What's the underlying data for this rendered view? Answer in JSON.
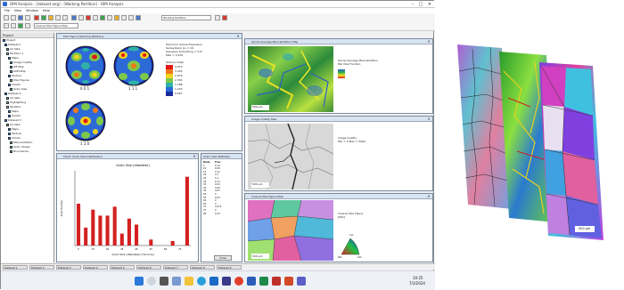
{
  "window": {
    "title": "OIM Analysis - [dataset.ang] - [Working Partition] - OIM Analysis",
    "controls": [
      "–",
      "□",
      "✕"
    ]
  },
  "menu": [
    "File",
    "View",
    "Window",
    "Help"
  ],
  "toolbar": {
    "partition_combo": "Working Partition",
    "map_combo": "Inverse Pole Figure Map"
  },
  "tree": {
    "header": "Project",
    "items": [
      "Project",
      "Dataset 1",
      "All data",
      "Partition 1",
      "Maps",
      "Image Quality",
      "IPF Map",
      "KAM Map",
      "Texture",
      "Pole Figures",
      "Charts",
      "Grain Size",
      "Dataset 2",
      "All data",
      "Highlighting",
      "Partition",
      "Maps",
      "Charts",
      "Dataset 3",
      "All data",
      "Maps",
      "Texture",
      "Charts",
      "Misorientation",
      "Grain Shape",
      "Boundaries"
    ]
  },
  "panels": {
    "pole_figure": {
      "title": "Pole Figure [Working Partition]",
      "labels": [
        "0 0 1",
        "1 1 1",
        "1 1 0"
      ],
      "legend_title": "Texture Index",
      "legend_values": [
        "3.970",
        "3.425",
        "2.879",
        "2.334",
        "1.788",
        "1.243",
        "0.697"
      ],
      "info": [
        "Harmonic Series Expansion",
        "Series Rank (L) = 16",
        "Gaussian Smoothing = 5.0°",
        "Max = 3.970"
      ],
      "colors": [
        "#e01818",
        "#f0781a",
        "#f2d21e",
        "#7cc84a",
        "#2fb0a8",
        "#2c6ad8",
        "#1a2a9a"
      ]
    },
    "map_top": {
      "title": "Kernel Average Misorientation Map",
      "scalebar": "500 μm",
      "info": [
        "Kernel Average Misorientation",
        "Min Max Fraction"
      ]
    },
    "map_mid": {
      "title": "Image Quality Map",
      "scalebar": "500 μm",
      "info": [
        "Image Quality",
        "Min = 0  Max = 5000"
      ]
    },
    "map_bot": {
      "title": "Inverse Pole Figure Map",
      "scalebar": "500 μm",
      "info": [
        "Inverse Pole Figure",
        "[001]",
        "111",
        "001",
        "101"
      ]
    },
    "chart": {
      "title": "Chart: Grain Size Distribution"
    },
    "table": {
      "title": "Grain Size Statistics",
      "header": [
        "Diam.",
        "Frac."
      ],
      "button": "Close"
    }
  },
  "chart_data": {
    "type": "bar",
    "title": "Grain Size (diameter)",
    "xlabel": "Grain Size (diameter) (microns)",
    "ylabel": "Area Fraction",
    "x": [
      5,
      10,
      15,
      20,
      25,
      30,
      35,
      40,
      45,
      50,
      55,
      60,
      65,
      70,
      75,
      80
    ],
    "values": [
      0.14,
      0.06,
      0.12,
      0.1,
      0.1,
      0.13,
      0.04,
      0.09,
      0.07,
      0.0,
      0.02,
      0.0,
      0.0,
      0.015,
      0.0,
      0.23
    ],
    "ylim": [
      0,
      0.25
    ],
    "color": "#d42020"
  },
  "status_tabs": [
    "Dataset 1",
    "Dataset 2",
    "Dataset 3",
    "Dataset 4",
    "Dataset 5",
    "Dataset 6",
    "Dataset 7",
    "Dataset 8",
    "Dataset 9"
  ],
  "taskbar": {
    "clock_time": "10:25",
    "clock_date": "7/3/2024"
  },
  "stack_scalebar": "500 μm"
}
